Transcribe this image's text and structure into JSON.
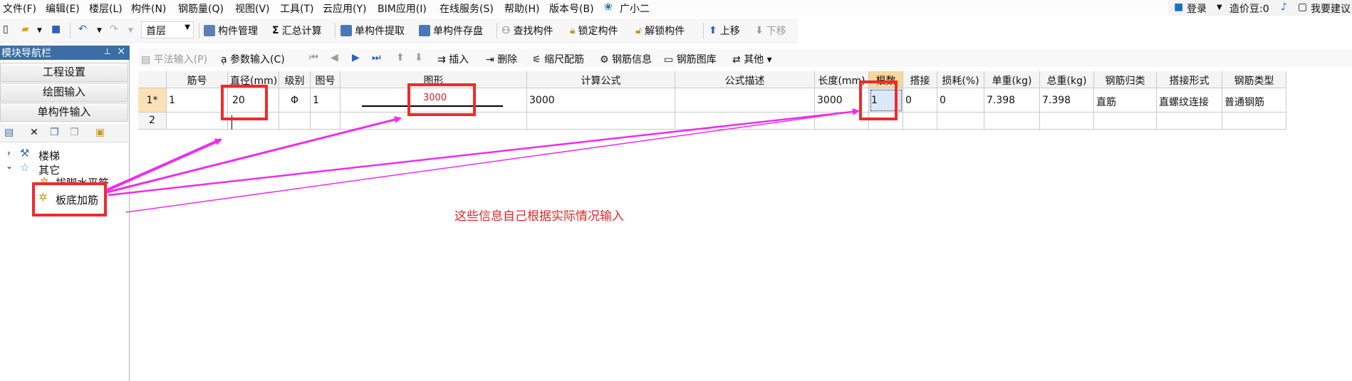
{
  "menu": {
    "items": [
      "文件(F)",
      "编辑(E)",
      "楼层(L)",
      "构件(N)",
      "钢筋量(Q)",
      "视图(V)",
      "工具(T)",
      "云应用(Y)",
      "BIM应用(I)",
      "在线服务(S)",
      "帮助(H)",
      "版本号(B)",
      "广小二"
    ],
    "right": {
      "login": "登录",
      "coins": "造价豆:0",
      "suggest": "我要建议"
    }
  },
  "toolbar": {
    "floor": "首层",
    "component_manage": "构件管理",
    "summary_calc": "汇总计算",
    "single_extract": "单构件提取",
    "single_save": "单构件存盘",
    "find_component": "查找构件",
    "lock_component": "锁定构件",
    "unlock_component": "解锁构件",
    "move_up": "上移",
    "move_down": "下移"
  },
  "nav": {
    "title": "模块导航栏",
    "pin": "ᵖ",
    "close": "×",
    "tabs": [
      "工程设置",
      "绘图输入",
      "单构件输入"
    ],
    "tree": {
      "stairs": "楼梯",
      "other": "其它",
      "partial_child": "拔脚水平筋",
      "selected": "板底加筋"
    }
  },
  "toolbar2": {
    "flat_input": "平法输入(P)",
    "param_input": "参数输入(C)",
    "insert": "插入",
    "delete": "删除",
    "scale_rebar": "缩尺配筋",
    "rebar_info": "钢筋信息",
    "rebar_library": "钢筋图库",
    "other": "其他"
  },
  "grid": {
    "headers": [
      "",
      "筋号",
      "直径(mm)",
      "级别",
      "图号",
      "图形",
      "计算公式",
      "公式描述",
      "长度(mm)",
      "根数",
      "搭接",
      "损耗(%)",
      "单重(kg)",
      "总重(kg)",
      "钢筋归类",
      "搭接形式",
      "钢筋类型"
    ],
    "rows": [
      [
        "1*",
        "1",
        "20",
        "Φ",
        "1",
        "3000",
        "3000",
        "",
        "3000",
        "1",
        "0",
        "0",
        "7.398",
        "7.398",
        "直筋",
        "直螺纹连接",
        "普通钢筋"
      ],
      [
        "2",
        "",
        "",
        "",
        "",
        "",
        "",
        "",
        "",
        "",
        "",
        "",
        "",
        "",
        "",
        "",
        ""
      ]
    ]
  },
  "annotation": {
    "text": "这些信息自己根据实际情况输入"
  }
}
